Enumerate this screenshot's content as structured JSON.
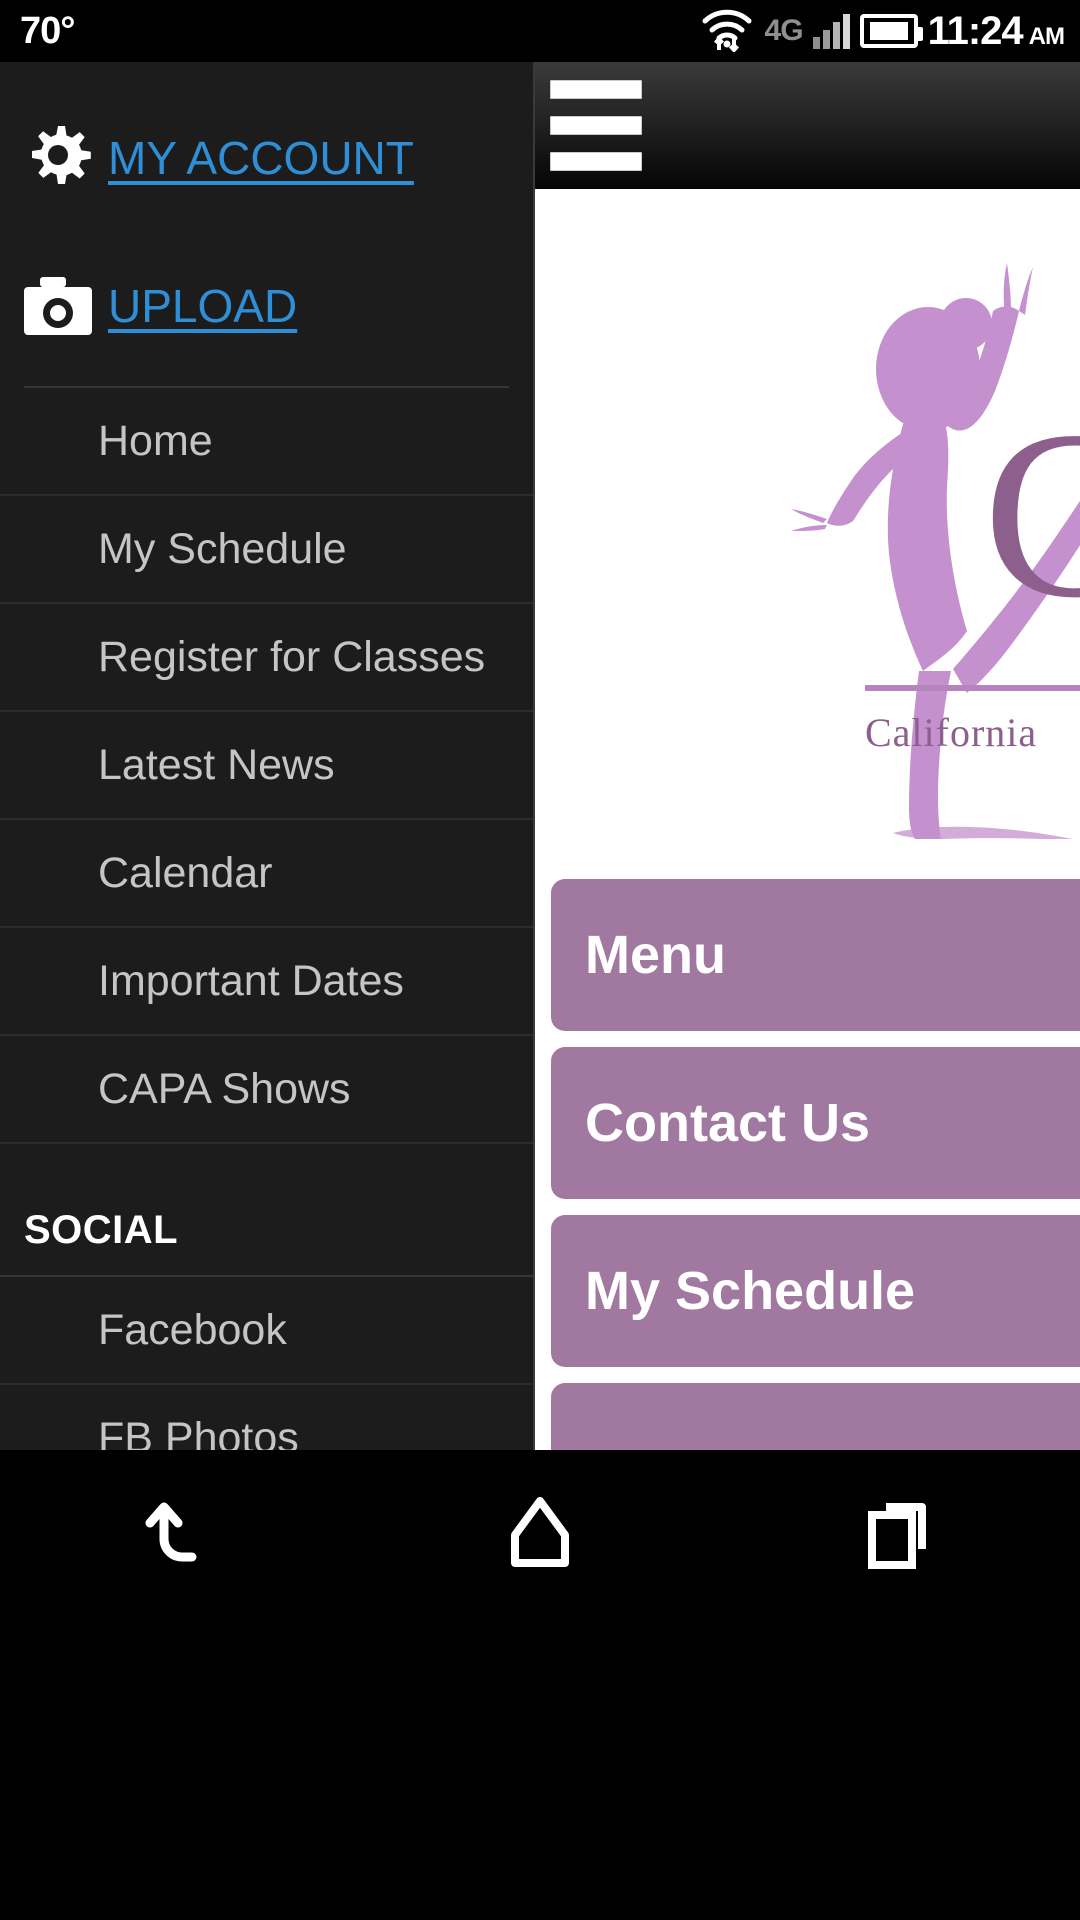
{
  "status_bar": {
    "temperature": "70°",
    "network_label": "4G",
    "time": "11:24",
    "am_pm": "AM",
    "icons": [
      "wifi-icon",
      "signal-bars-icon",
      "battery-icon"
    ]
  },
  "drawer": {
    "account_link": {
      "label": "MY ACCOUNT",
      "icon": "gear-icon"
    },
    "upload_link": {
      "label": "UPLOAD",
      "icon": "camera-icon"
    },
    "link_color": "#2f8fd6",
    "items": [
      {
        "label": "Home"
      },
      {
        "label": "My Schedule"
      },
      {
        "label": "Register for Classes"
      },
      {
        "label": "Latest News"
      },
      {
        "label": "Calendar"
      },
      {
        "label": "Important Dates"
      },
      {
        "label": "CAPA Shows"
      }
    ],
    "social_heading": "SOCIAL",
    "social_items": [
      {
        "label": "Facebook"
      },
      {
        "label": "FB Photos"
      }
    ]
  },
  "page": {
    "menu_icon": "hamburger-menu-icon",
    "logo": {
      "mark": "ballerina-dancer-icon",
      "letter": "C",
      "subtitle": "California ",
      "mark_color": "#c490cd",
      "text_color": "#8d5f8d"
    },
    "buttons": [
      {
        "label": "Menu"
      },
      {
        "label": "Contact Us"
      },
      {
        "label": "My Schedule"
      },
      {
        "label": ""
      }
    ],
    "button_color": "#a078a0"
  },
  "navbar": {
    "buttons": [
      {
        "name": "back",
        "icon": "back-arrow-icon"
      },
      {
        "name": "home",
        "icon": "home-icon"
      },
      {
        "name": "recents",
        "icon": "recent-apps-icon"
      }
    ]
  }
}
